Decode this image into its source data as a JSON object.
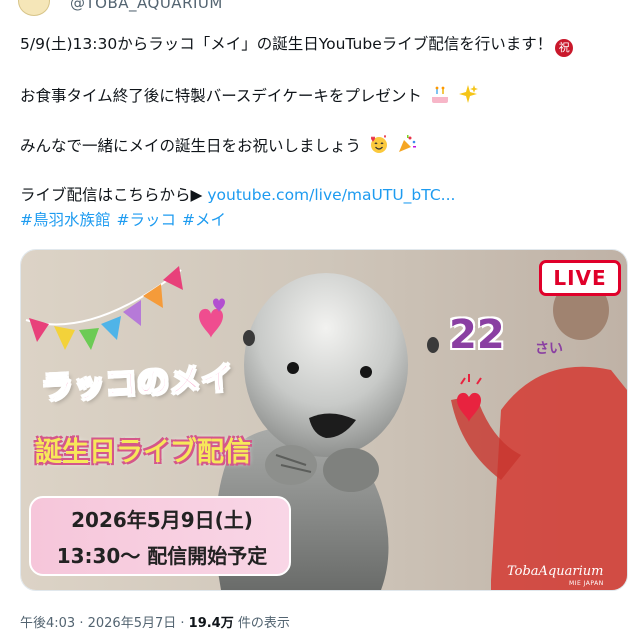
{
  "account": {
    "handle": "@TOBA_AQUARIUM"
  },
  "tweet": {
    "line1": "5/9(土)13:30からラッコ「メイ」の誕生日YouTubeライブ配信を行います！",
    "line1_emoji": "祝",
    "line2": "お食事タイム終了後に特製バースデイケーキをプレゼント",
    "line3": "みんなで一緒にメイの誕生日をお祝いしましょう",
    "line4_prefix": "ライブ配信はこちらから▶ ",
    "link": "youtube.com/live/maUTU_bTC...",
    "hashtags": [
      "#鳥羽水族館",
      "#ラッコ",
      "#メイ"
    ],
    "icons": [
      "cake-icon",
      "sparkles-icon",
      "smiling-face-with-hearts-icon",
      "party-popper-icon"
    ]
  },
  "media": {
    "live_badge": "LIVE",
    "title": "ラッコのメイ",
    "event": "誕生日ライブ配信",
    "date_line1": "2026年5月9日(土)",
    "date_line2": "13:30〜 配信開始予定",
    "age": "22",
    "age_unit": "さい",
    "watermark": "TobaAquarium",
    "watermark_sub": "MIE JAPAN"
  },
  "meta": {
    "time": "午後4:03",
    "sep": " · ",
    "date": "2026年5月7日",
    "views": "19.4万",
    "views_label": " 件の表示"
  },
  "colors": {
    "link": "#1d9bf0",
    "text": "#0f1419",
    "muted": "#536471",
    "live_red": "#e0002a"
  }
}
